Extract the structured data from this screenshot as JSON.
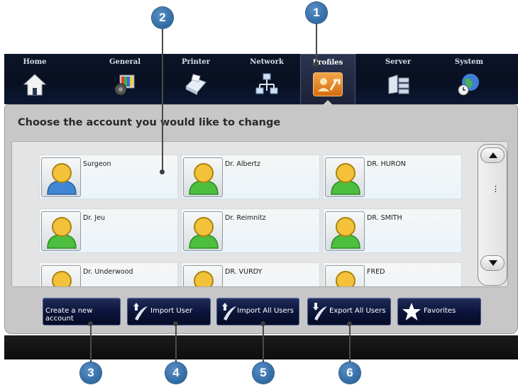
{
  "callouts": [
    "1",
    "2",
    "3",
    "4",
    "5",
    "6"
  ],
  "nav": {
    "items": [
      {
        "label": "Home",
        "icon": "home-icon"
      },
      {
        "label": "General",
        "icon": "general-settings-icon"
      },
      {
        "label": "Printer",
        "icon": "printer-icon"
      },
      {
        "label": "Network",
        "icon": "network-icon"
      },
      {
        "label": "Profiles",
        "icon": "profiles-icon",
        "active": true
      },
      {
        "label": "Server",
        "icon": "server-icon"
      },
      {
        "label": "System",
        "icon": "system-globe-icon"
      }
    ]
  },
  "panel": {
    "title": "Choose the account you would like to change"
  },
  "accounts": [
    {
      "name": "Surgeon",
      "color": "blue"
    },
    {
      "name": "Dr. Albertz",
      "color": "green"
    },
    {
      "name": "DR. HURON",
      "color": "blue"
    },
    {
      "name": "Dr. Jeu",
      "color": "green"
    },
    {
      "name": "Dr. Reimnitz",
      "color": "green"
    },
    {
      "name": "DR. SMITH",
      "color": "green"
    },
    {
      "name": "Dr. Underwood",
      "color": "green"
    },
    {
      "name": "DR. VURDY",
      "color": "green"
    },
    {
      "name": "FRED",
      "color": "green"
    }
  ],
  "scroll": {
    "dots": "⋮"
  },
  "buttons": {
    "create": "Create a new account",
    "import_user": "Import User",
    "import_all": "Import All Users",
    "export_all": "Export All Users",
    "favorites": "Favorites"
  },
  "colors": {
    "callout": "#2f6aa3",
    "nav_bg": "#081021",
    "active_tab": "#e8891e",
    "panel_bg": "#c7c7c7",
    "button_bg": "#0b1338"
  }
}
